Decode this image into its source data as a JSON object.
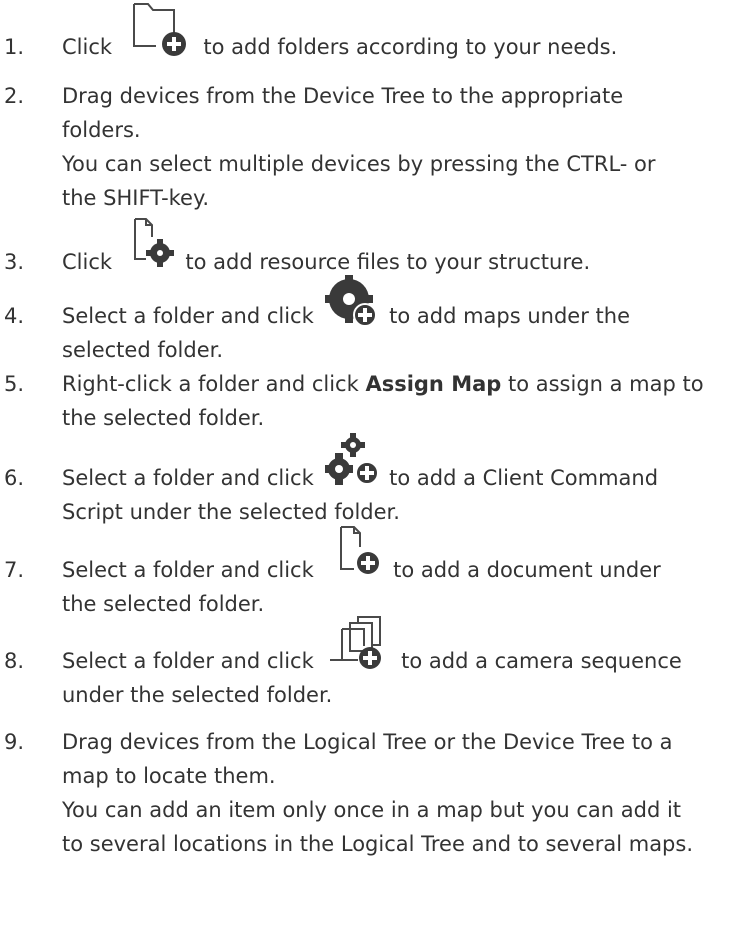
{
  "steps": [
    {
      "num": "1.",
      "a": "Click",
      "b": "to add folders according to your needs.",
      "icon": "new-folder-icon"
    },
    {
      "num": "2.",
      "l1": "Drag devices from the Device Tree to the appropriate",
      "l2": "folders.",
      "l3": "You can select multiple devices by pressing the CTRL- or",
      "l4": "the SHIFT-key."
    },
    {
      "num": "3.",
      "a": "Click",
      "b": "to add resource files to your structure.",
      "icon": "add-resource-icon"
    },
    {
      "num": "4.",
      "a": "Select a folder and click",
      "b": "to add maps under the",
      "l2": "selected folder.",
      "icon": "add-map-icon"
    },
    {
      "num": "5.",
      "a": "Right-click a folder and click",
      "bold": "Assign Map",
      "b": "to assign a map to",
      "l2": "the selected folder."
    },
    {
      "num": "6.",
      "a": "Select a folder and click",
      "b": "to add a Client Command",
      "l2": "Script under the selected folder.",
      "icon": "add-script-icon"
    },
    {
      "num": "7.",
      "a": "Select a folder and click",
      "b": "to add a document under",
      "l2": "the selected folder.",
      "icon": "add-document-icon"
    },
    {
      "num": "8.",
      "a": "Select a folder and click",
      "b": "to add a camera sequence",
      "l2": "under the selected folder.",
      "icon": "add-sequence-icon"
    },
    {
      "num": "9.",
      "l1": "Drag devices from the Logical Tree or the Device Tree to a",
      "l2": "map to locate them.",
      "l3": "You can add an item only once in a map but you can add it",
      "l4": "to several locations in the Logical Tree and to several maps."
    }
  ],
  "colors": {
    "text": "#333333",
    "icon": "#3a3a3a",
    "icon_outline": "#4a4a4a"
  }
}
